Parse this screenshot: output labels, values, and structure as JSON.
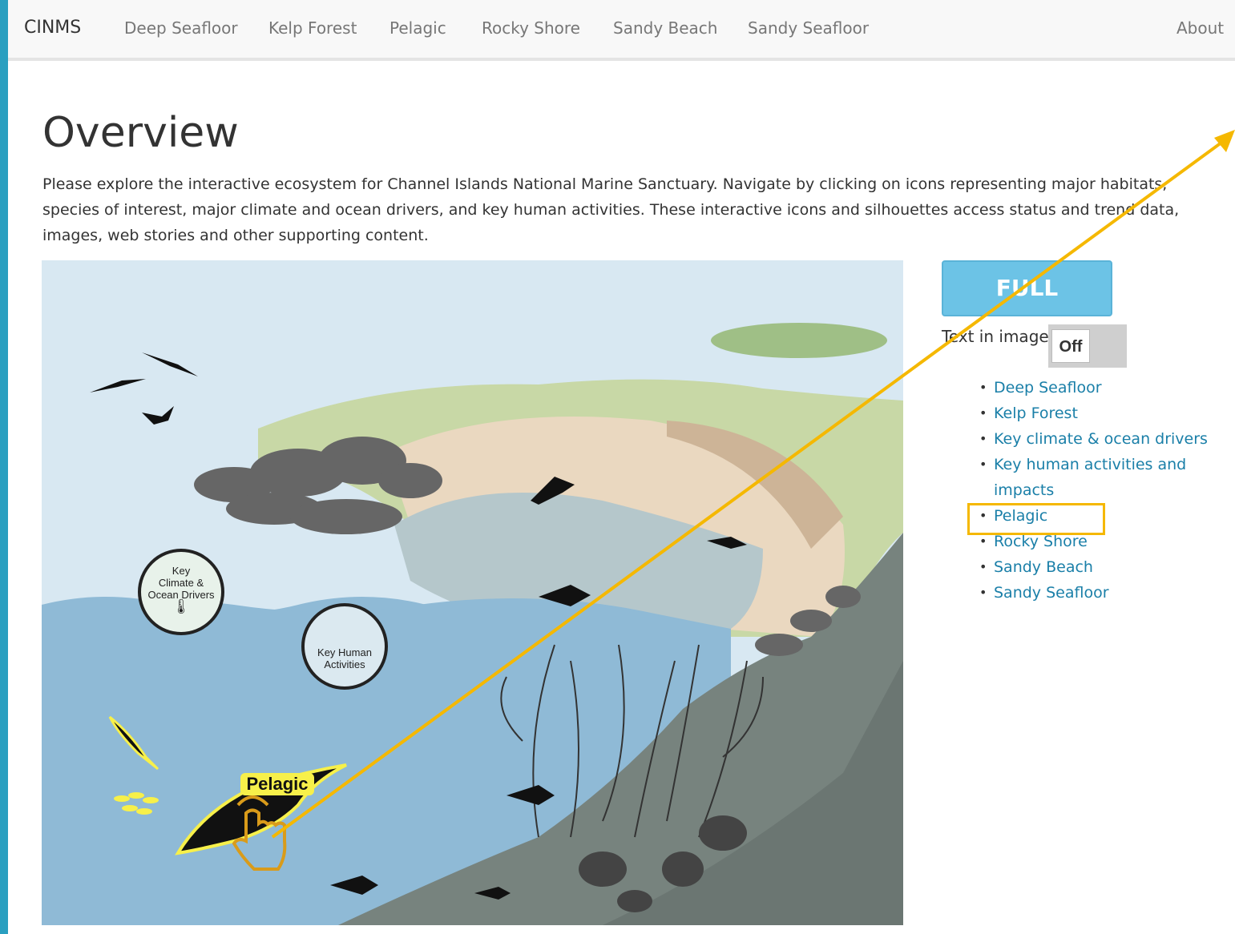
{
  "nav": {
    "brand": "CINMS",
    "links": [
      "Deep Seafloor",
      "Kelp Forest",
      "Pelagic",
      "Rocky Shore",
      "Sandy Beach",
      "Sandy Seafloor"
    ],
    "about": "About"
  },
  "main": {
    "title": "Overview",
    "intro": "Please explore the interactive ecosystem for Channel Islands National Marine Sanctuary. Navigate by clicking on icons representing major habitats, species of interest, major climate and ocean drivers, and key human activities. These interactive icons and silhouettes access status and trend data, images, web stories and other supporting content."
  },
  "scene": {
    "climate_badge": [
      "Key",
      "Climate &",
      "Ocean Drivers"
    ],
    "human_badge": [
      "Key Human",
      "Activities"
    ],
    "pelagic_label": "Pelagic"
  },
  "sidebar": {
    "full_screen_label": "FULL SCREEN",
    "text_in_image_label": "Text in image:",
    "toggle_value": "Off",
    "habitat_links": [
      "Deep Seafloor",
      "Kelp Forest",
      "Key climate & ocean drivers",
      "Key human activities and impacts",
      "Pelagic",
      "Rocky Shore",
      "Sandy Beach",
      "Sandy Seafloor"
    ]
  },
  "colors": {
    "frame": "#2a9fc0",
    "link": "#1a7fa8",
    "button": "#6cc3e6",
    "annotation": "#f5b800",
    "pelagic_highlight": "#f7f04a"
  }
}
